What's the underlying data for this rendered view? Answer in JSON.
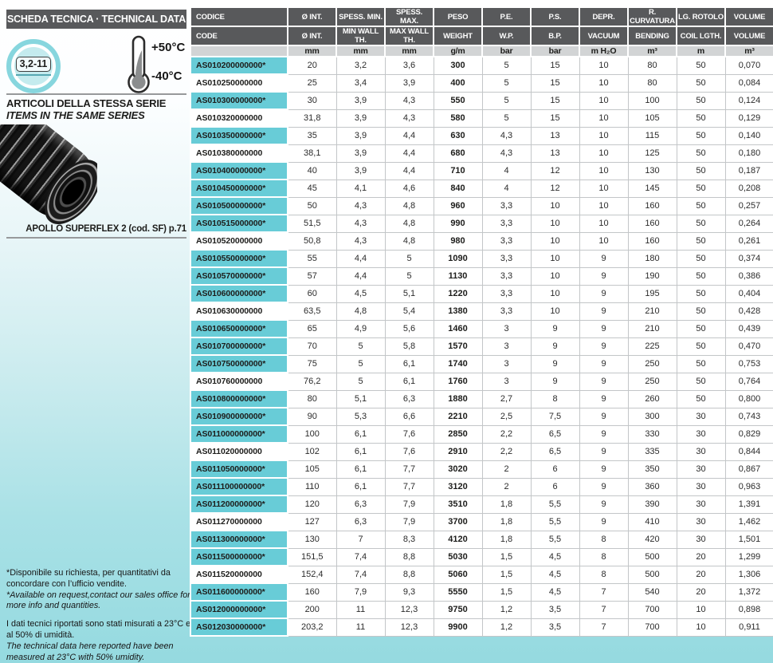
{
  "sidebar": {
    "header": "SCHEDA TECNICA · TECHNICAL DATA",
    "badge": "3,2-11",
    "temp_high": "+50°C",
    "temp_low": "-40°C",
    "series_title_it": "ARTICOLI DELLA STESSA SERIE",
    "series_title_en": "ITEMS IN THE SAME SERIES",
    "product_caption": "APOLLO SUPERFLEX 2  (cod. SF) p.71",
    "notes": {
      "availability_it": "*Disponibile su richiesta, per quantitativi da concordare con l’ufficio vendite.",
      "availability_en": "*Available on request,contact our sales office for more info and quantities.",
      "measured_it": "I dati tecnici riportati sono stati misurati a 23°C e al 50% di umidità.",
      "measured_en": "The technical data here reported have been measured at 23°C with 50% umidity."
    }
  },
  "colors": {
    "header_gray": "#58595b",
    "units_gray": "#d2d4d5",
    "highlight_teal": "#68ccd7",
    "page_cyan": "#9edde3"
  },
  "table": {
    "header_row1": [
      "CODICE",
      "Ø INT.",
      "SPESS. MIN.",
      "SPESS. MAX.",
      "PESO",
      "P.E.",
      "P.S.",
      "DEPR.",
      "R. CURVATURA",
      "LG. ROTOLO",
      "VOLUME"
    ],
    "header_row2": [
      "CODE",
      "Ø INT.",
      "MIN WALL TH.",
      "MAX WALL TH.",
      "WEIGHT",
      "W.P.",
      "B.P.",
      "VACUUM",
      "BENDING",
      "COIL LGTH.",
      "VOLUME"
    ],
    "units": [
      "",
      "mm",
      "mm",
      "mm",
      "g/m",
      "bar",
      "bar",
      "m H₂O",
      "m³",
      "m",
      "m³"
    ],
    "rows": [
      {
        "code": "AS010200000000*",
        "starred": true,
        "values": [
          "20",
          "3,2",
          "3,6",
          "300",
          "5",
          "15",
          "10",
          "80",
          "50",
          "0,070"
        ]
      },
      {
        "code": "AS010250000000",
        "starred": false,
        "values": [
          "25",
          "3,4",
          "3,9",
          "400",
          "5",
          "15",
          "10",
          "80",
          "50",
          "0,084"
        ]
      },
      {
        "code": "AS010300000000*",
        "starred": true,
        "values": [
          "30",
          "3,9",
          "4,3",
          "550",
          "5",
          "15",
          "10",
          "100",
          "50",
          "0,124"
        ]
      },
      {
        "code": "AS010320000000",
        "starred": false,
        "values": [
          "31,8",
          "3,9",
          "4,3",
          "580",
          "5",
          "15",
          "10",
          "105",
          "50",
          "0,129"
        ]
      },
      {
        "code": "AS010350000000*",
        "starred": true,
        "values": [
          "35",
          "3,9",
          "4,4",
          "630",
          "4,3",
          "13",
          "10",
          "115",
          "50",
          "0,140"
        ]
      },
      {
        "code": "AS010380000000",
        "starred": false,
        "values": [
          "38,1",
          "3,9",
          "4,4",
          "680",
          "4,3",
          "13",
          "10",
          "125",
          "50",
          "0,180"
        ]
      },
      {
        "code": "AS010400000000*",
        "starred": true,
        "values": [
          "40",
          "3,9",
          "4,4",
          "710",
          "4",
          "12",
          "10",
          "130",
          "50",
          "0,187"
        ]
      },
      {
        "code": "AS010450000000*",
        "starred": true,
        "values": [
          "45",
          "4,1",
          "4,6",
          "840",
          "4",
          "12",
          "10",
          "145",
          "50",
          "0,208"
        ]
      },
      {
        "code": "AS010500000000*",
        "starred": true,
        "values": [
          "50",
          "4,3",
          "4,8",
          "960",
          "3,3",
          "10",
          "10",
          "160",
          "50",
          "0,257"
        ]
      },
      {
        "code": "AS010515000000*",
        "starred": true,
        "values": [
          "51,5",
          "4,3",
          "4,8",
          "990",
          "3,3",
          "10",
          "10",
          "160",
          "50",
          "0,264"
        ]
      },
      {
        "code": "AS010520000000",
        "starred": false,
        "values": [
          "50,8",
          "4,3",
          "4,8",
          "980",
          "3,3",
          "10",
          "10",
          "160",
          "50",
          "0,261"
        ]
      },
      {
        "code": "AS010550000000*",
        "starred": true,
        "values": [
          "55",
          "4,4",
          "5",
          "1090",
          "3,3",
          "10",
          "9",
          "180",
          "50",
          "0,374"
        ]
      },
      {
        "code": "AS010570000000*",
        "starred": true,
        "values": [
          "57",
          "4,4",
          "5",
          "1130",
          "3,3",
          "10",
          "9",
          "190",
          "50",
          "0,386"
        ]
      },
      {
        "code": "AS010600000000*",
        "starred": true,
        "values": [
          "60",
          "4,5",
          "5,1",
          "1220",
          "3,3",
          "10",
          "9",
          "195",
          "50",
          "0,404"
        ]
      },
      {
        "code": "AS010630000000",
        "starred": false,
        "values": [
          "63,5",
          "4,8",
          "5,4",
          "1380",
          "3,3",
          "10",
          "9",
          "210",
          "50",
          "0,428"
        ]
      },
      {
        "code": "AS010650000000*",
        "starred": true,
        "values": [
          "65",
          "4,9",
          "5,6",
          "1460",
          "3",
          "9",
          "9",
          "210",
          "50",
          "0,439"
        ]
      },
      {
        "code": "AS010700000000*",
        "starred": true,
        "values": [
          "70",
          "5",
          "5,8",
          "1570",
          "3",
          "9",
          "9",
          "225",
          "50",
          "0,470"
        ]
      },
      {
        "code": "AS010750000000*",
        "starred": true,
        "values": [
          "75",
          "5",
          "6,1",
          "1740",
          "3",
          "9",
          "9",
          "250",
          "50",
          "0,753"
        ]
      },
      {
        "code": "AS010760000000",
        "starred": false,
        "values": [
          "76,2",
          "5",
          "6,1",
          "1760",
          "3",
          "9",
          "9",
          "250",
          "50",
          "0,764"
        ]
      },
      {
        "code": "AS010800000000*",
        "starred": true,
        "values": [
          "80",
          "5,1",
          "6,3",
          "1880",
          "2,7",
          "8",
          "9",
          "260",
          "50",
          "0,800"
        ]
      },
      {
        "code": "AS010900000000*",
        "starred": true,
        "values": [
          "90",
          "5,3",
          "6,6",
          "2210",
          "2,5",
          "7,5",
          "9",
          "300",
          "30",
          "0,743"
        ]
      },
      {
        "code": "AS011000000000*",
        "starred": true,
        "values": [
          "100",
          "6,1",
          "7,6",
          "2850",
          "2,2",
          "6,5",
          "9",
          "330",
          "30",
          "0,829"
        ]
      },
      {
        "code": "AS011020000000",
        "starred": false,
        "values": [
          "102",
          "6,1",
          "7,6",
          "2910",
          "2,2",
          "6,5",
          "9",
          "335",
          "30",
          "0,844"
        ]
      },
      {
        "code": "AS011050000000*",
        "starred": true,
        "values": [
          "105",
          "6,1",
          "7,7",
          "3020",
          "2",
          "6",
          "9",
          "350",
          "30",
          "0,867"
        ]
      },
      {
        "code": "AS011100000000*",
        "starred": true,
        "values": [
          "110",
          "6,1",
          "7,7",
          "3120",
          "2",
          "6",
          "9",
          "360",
          "30",
          "0,963"
        ]
      },
      {
        "code": "AS011200000000*",
        "starred": true,
        "values": [
          "120",
          "6,3",
          "7,9",
          "3510",
          "1,8",
          "5,5",
          "9",
          "390",
          "30",
          "1,391"
        ]
      },
      {
        "code": "AS011270000000",
        "starred": false,
        "values": [
          "127",
          "6,3",
          "7,9",
          "3700",
          "1,8",
          "5,5",
          "9",
          "410",
          "30",
          "1,462"
        ]
      },
      {
        "code": "AS011300000000*",
        "starred": true,
        "values": [
          "130",
          "7",
          "8,3",
          "4120",
          "1,8",
          "5,5",
          "8",
          "420",
          "30",
          "1,501"
        ]
      },
      {
        "code": "AS011500000000*",
        "starred": true,
        "values": [
          "151,5",
          "7,4",
          "8,8",
          "5030",
          "1,5",
          "4,5",
          "8",
          "500",
          "20",
          "1,299"
        ]
      },
      {
        "code": "AS011520000000",
        "starred": false,
        "values": [
          "152,4",
          "7,4",
          "8,8",
          "5060",
          "1,5",
          "4,5",
          "8",
          "500",
          "20",
          "1,306"
        ]
      },
      {
        "code": "AS011600000000*",
        "starred": true,
        "values": [
          "160",
          "7,9",
          "9,3",
          "5550",
          "1,5",
          "4,5",
          "7",
          "540",
          "20",
          "1,372"
        ]
      },
      {
        "code": "AS012000000000*",
        "starred": true,
        "values": [
          "200",
          "11",
          "12,3",
          "9750",
          "1,2",
          "3,5",
          "7",
          "700",
          "10",
          "0,898"
        ]
      },
      {
        "code": "AS012030000000*",
        "starred": true,
        "values": [
          "203,2",
          "11",
          "12,3",
          "9900",
          "1,2",
          "3,5",
          "7",
          "700",
          "10",
          "0,911"
        ]
      }
    ]
  }
}
